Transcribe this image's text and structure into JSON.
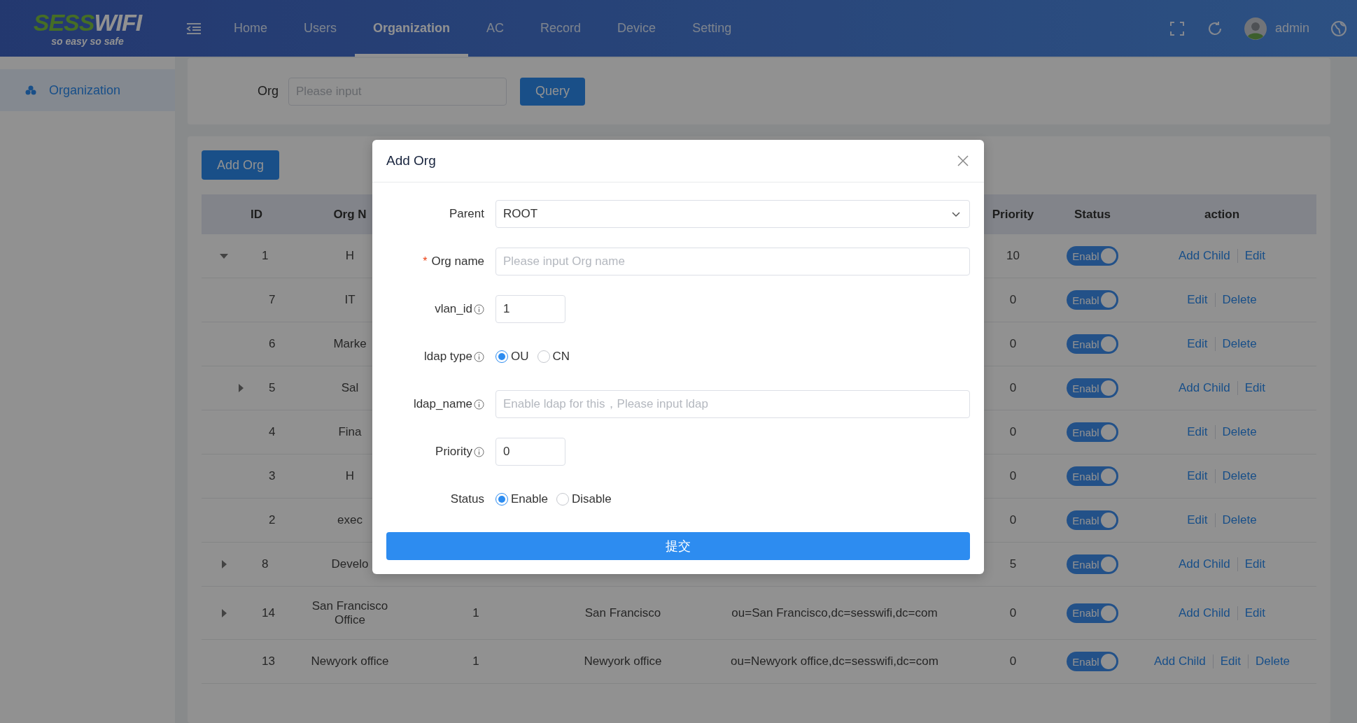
{
  "header": {
    "logo": {
      "word_1": "SESS",
      "word_2": "WIFI",
      "tagline": "so easy so safe"
    },
    "nav": [
      {
        "label": "Home",
        "selected": false
      },
      {
        "label": "Users",
        "selected": false
      },
      {
        "label": "Organization",
        "selected": true
      },
      {
        "label": "AC",
        "selected": false
      },
      {
        "label": "Record",
        "selected": false
      },
      {
        "label": "Device",
        "selected": false
      },
      {
        "label": "Setting",
        "selected": false
      }
    ],
    "user": "admin"
  },
  "sidebar": {
    "items": [
      {
        "label": "Organization",
        "selected": true
      }
    ]
  },
  "search": {
    "label": "Org",
    "placeholder": "Please input",
    "button": "Query"
  },
  "toolbar": {
    "add_button": "Add Org"
  },
  "table": {
    "columns": {
      "id": "ID",
      "org_name": "Org N",
      "priority": "Priority",
      "status": "Status",
      "action": "action"
    },
    "rows": [
      {
        "id": "1",
        "org_name": "H",
        "priority": "10",
        "status": {
          "label": "Enabl",
          "on": true
        },
        "actions": [
          "Add Child",
          "Edit"
        ],
        "expanded": true,
        "children": [
          {
            "id": "7",
            "org_name": "IT",
            "priority": "0",
            "status": {
              "label": "Enabl",
              "on": true
            },
            "actions": [
              "Edit",
              "Delete"
            ]
          },
          {
            "id": "6",
            "org_name": "Marke",
            "priority": "0",
            "status": {
              "label": "Enabl",
              "on": true
            },
            "actions": [
              "Edit",
              "Delete"
            ]
          },
          {
            "id": "5",
            "org_name": "Sal",
            "priority": "0",
            "status": {
              "label": "Enabl",
              "on": true
            },
            "actions": [
              "Add Child",
              "Edit"
            ],
            "expanded": false
          },
          {
            "id": "4",
            "org_name": "Fina",
            "priority": "0",
            "status": {
              "label": "Enabl",
              "on": true
            },
            "actions": [
              "Edit",
              "Delete"
            ]
          },
          {
            "id": "3",
            "org_name": "H",
            "priority": "0",
            "status": {
              "label": "Enabl",
              "on": true
            },
            "actions": [
              "Edit",
              "Delete"
            ]
          },
          {
            "id": "2",
            "org_name": "exec",
            "priority": "0",
            "status": {
              "label": "Enabl",
              "on": true
            },
            "actions": [
              "Edit",
              "Delete"
            ]
          }
        ]
      },
      {
        "id": "8",
        "org_name": "Develo",
        "priority": "5",
        "status": {
          "label": "Enabl",
          "on": true
        },
        "actions": [
          "Add Child",
          "Edit"
        ],
        "expanded": false
      },
      {
        "id": "14",
        "org_name": "San Francisco Office",
        "column_3": "1",
        "column_4": "San Francisco",
        "column_5": "ou=San Francisco,dc=sesswifi,dc=com",
        "priority": "0",
        "status": {
          "label": "Enabl",
          "on": true
        },
        "actions": [
          "Add Child",
          "Edit"
        ],
        "expanded": false
      },
      {
        "id": "13",
        "org_name": "Newyork office",
        "column_3": "1",
        "column_4": "Newyork office",
        "column_5": "ou=Newyork office,dc=sesswifi,dc=com",
        "priority": "0",
        "status": {
          "label": "Enabl",
          "on": true
        },
        "actions": [
          "Add Child",
          "Edit",
          "Delete"
        ]
      }
    ]
  },
  "modal": {
    "title": "Add Org",
    "fields": [
      {
        "kind": "select",
        "label": "Parent",
        "value": "ROOT",
        "info": false
      },
      {
        "kind": "input",
        "label": "Org name",
        "required_mark": "*",
        "placeholder": "Please input Org name",
        "info": false
      },
      {
        "kind": "short_input",
        "label": "vlan_id",
        "value": "1",
        "info": true
      },
      {
        "kind": "radio",
        "label": "ldap type",
        "info": true,
        "options": [
          {
            "label": "OU",
            "selected": true
          },
          {
            "label": "CN",
            "selected": false
          }
        ]
      },
      {
        "kind": "input",
        "label": "ldap_name",
        "placeholder": "Enable ldap for this，Please input ldap",
        "info": true
      },
      {
        "kind": "short_input",
        "label": "Priority",
        "value": "0",
        "info": true
      },
      {
        "kind": "radio",
        "label": "Status",
        "info": false,
        "options": [
          {
            "label": "Enable",
            "selected": true
          },
          {
            "label": "Disable",
            "selected": false
          }
        ]
      }
    ],
    "submit": "提交"
  }
}
